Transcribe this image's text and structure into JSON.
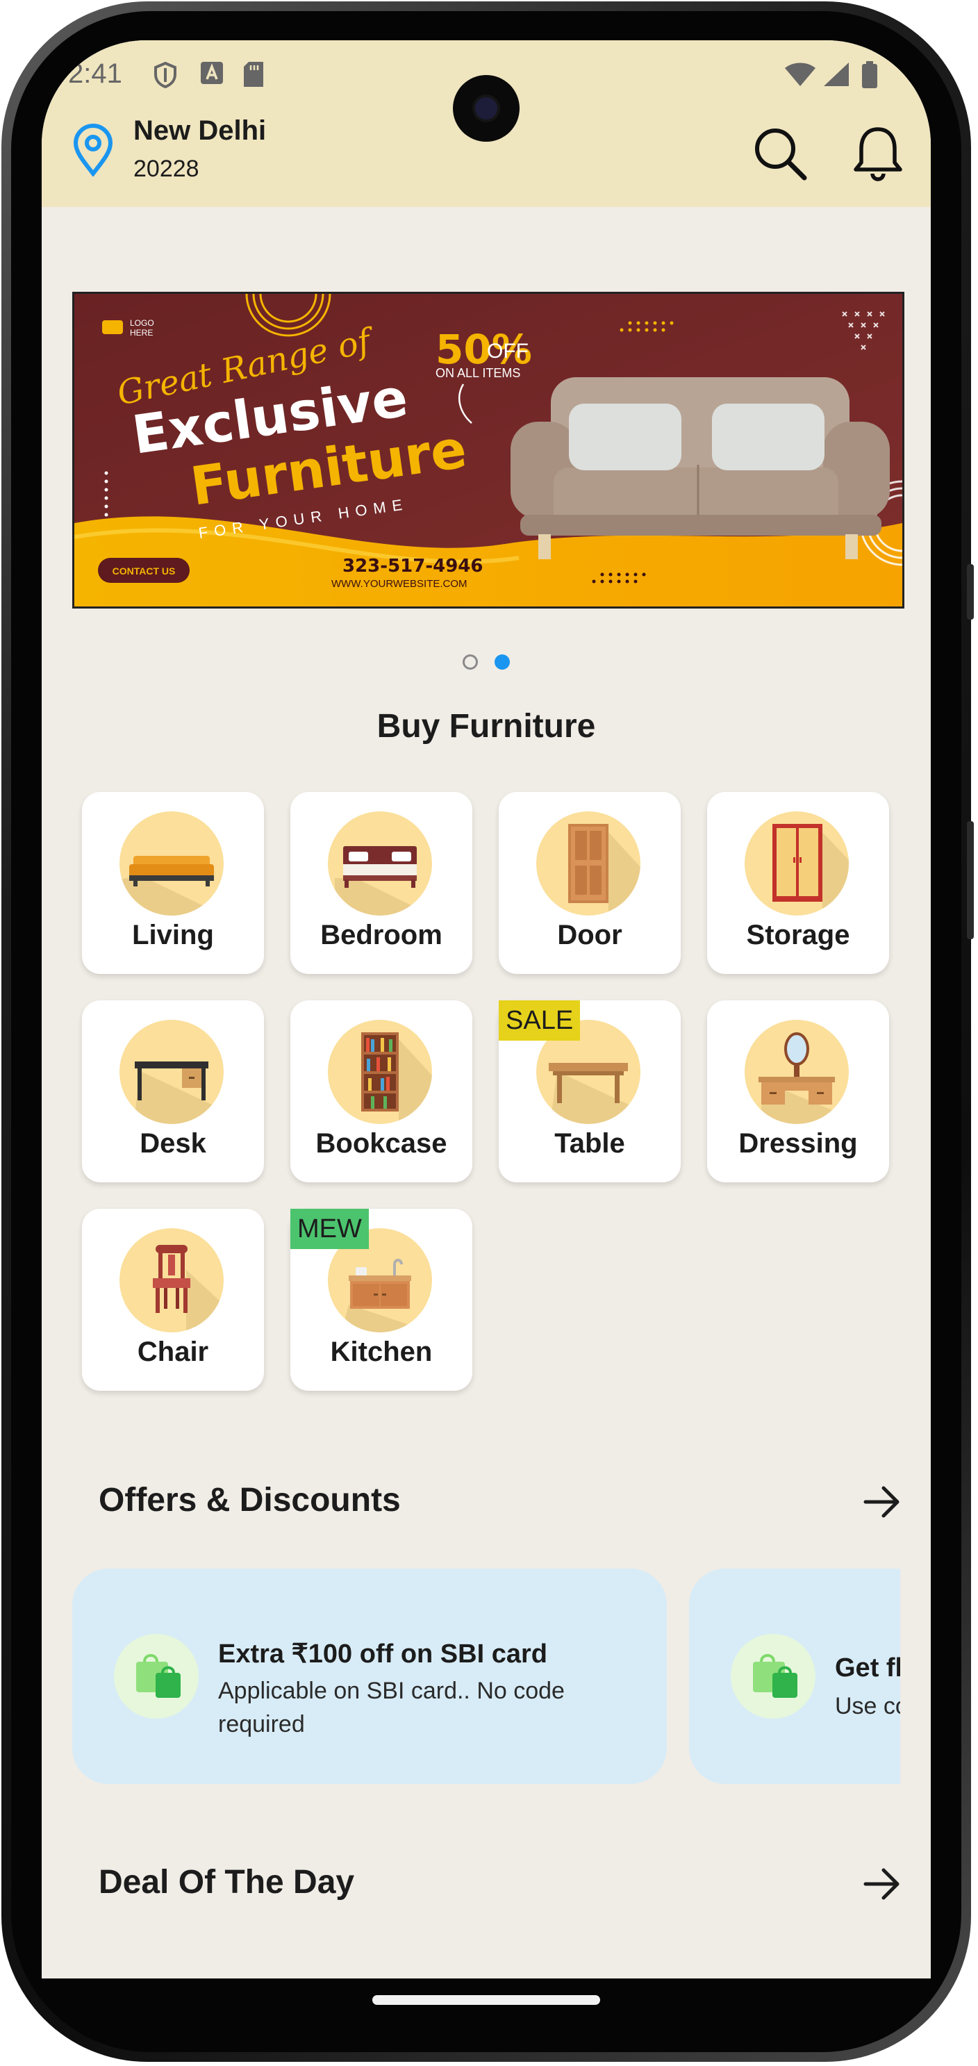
{
  "status_bar": {
    "time": "2:41"
  },
  "header": {
    "city": "New Delhi",
    "pincode": "20228"
  },
  "banner": {
    "logo_text_1": "LOGO",
    "logo_text_2": "HERE",
    "script_line": "Great Range of",
    "line2": "Exclusive",
    "line3": "Furniture",
    "line4": "FOR YOUR HOME",
    "discount": "50%",
    "off": "OFF",
    "all_items": "ON ALL ITEMS",
    "phone": "323-517-4946",
    "website": "WWW.YOURWEBSITE.COM",
    "contact_label": "CONTACT US"
  },
  "carousel": {
    "page_count": 2,
    "active_index": 1
  },
  "categories_title": "Buy Furniture",
  "categories": [
    {
      "label": "Living",
      "badge": ""
    },
    {
      "label": "Bedroom",
      "badge": ""
    },
    {
      "label": "Door",
      "badge": ""
    },
    {
      "label": "Storage",
      "badge": ""
    },
    {
      "label": "Desk",
      "badge": ""
    },
    {
      "label": "Bookcase",
      "badge": ""
    },
    {
      "label": "Table",
      "badge": "SALE"
    },
    {
      "label": "Dressing",
      "badge": ""
    },
    {
      "label": "Chair",
      "badge": ""
    },
    {
      "label": "Kitchen",
      "badge": "MEW"
    }
  ],
  "offers_title": "Offers  &  Discounts",
  "offers": [
    {
      "title": "Extra ₹100 off on SBI card",
      "subtitle": "Applicable on SBI card.. No code required"
    },
    {
      "title": "Get fl",
      "subtitle": "Use co"
    }
  ],
  "deal_title": "Deal Of The  Day",
  "colors": {
    "header_bg": "#efe5bf",
    "page_bg": "#f0ece6",
    "accent_blue": "#1a96f0",
    "category_circle": "#fbdf9a",
    "offer_card_bg": "#d8ecf7",
    "sale_badge": "#e6d21a",
    "new_badge": "#4cc46e"
  }
}
